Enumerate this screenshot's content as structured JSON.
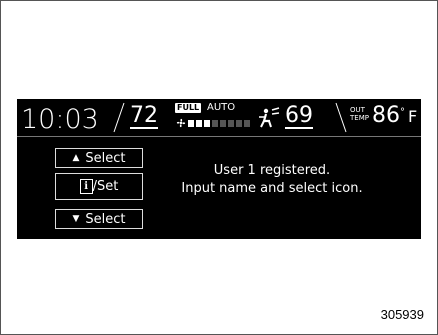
{
  "status_bar": {
    "time": "10:03",
    "driver_temp": "72",
    "fan_mode_badge": "FULL",
    "climate_mode": "AUTO",
    "fan_level": 0.375,
    "passenger_temp": "69",
    "outside_label_top": "OUT",
    "outside_label_bottom": "TEMP",
    "outside_temp": "86",
    "degree_symbol": "°",
    "unit": "F"
  },
  "menu": {
    "select_up_label": "Select",
    "info_set_label": "/Set",
    "info_icon_glyph": "i",
    "select_down_label": "Select"
  },
  "message": {
    "line1": "User 1 registered.",
    "line2": "Input name and select icon."
  },
  "figure_id": "305939",
  "colors": {
    "display_bg": "#000000",
    "text": "#ffffff"
  }
}
